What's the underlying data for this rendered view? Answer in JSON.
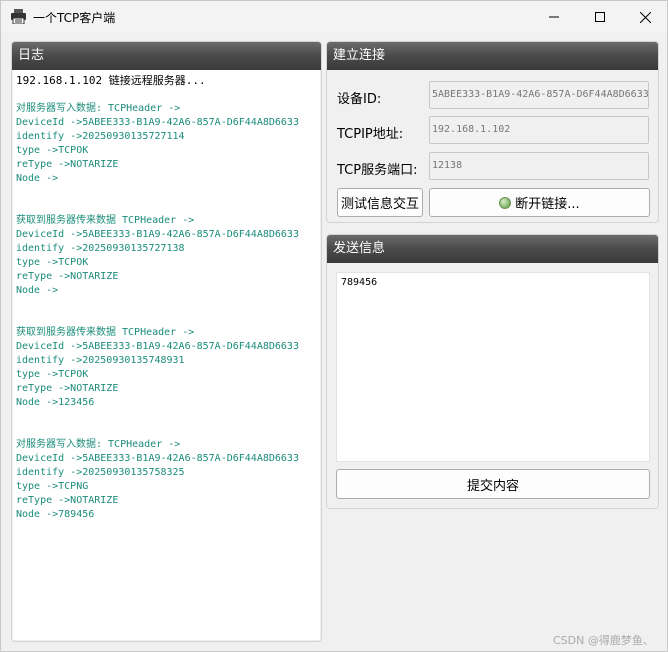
{
  "window": {
    "title": "一个TCP客户端"
  },
  "log_panel": {
    "header": "日志",
    "lines": [
      {
        "text": "192.168.1.102 链接远程服务器...",
        "style": "black"
      },
      {
        "text": "",
        "style": "blank"
      },
      {
        "text": "对服务器写入数据: TCPHeader ->",
        "style": "green"
      },
      {
        "text": "DeviceId ->5ABEE333-B1A9-42A6-857A-D6F44A8D6633",
        "style": "green"
      },
      {
        "text": "identify ->20250930135727114",
        "style": "green"
      },
      {
        "text": "type ->TCPOK",
        "style": "green"
      },
      {
        "text": "reType ->NOTARIZE",
        "style": "green"
      },
      {
        "text": "Node ->",
        "style": "green"
      },
      {
        "text": "",
        "style": "blank"
      },
      {
        "text": "",
        "style": "blank"
      },
      {
        "text": "获取到服务器传来数据 TCPHeader ->",
        "style": "green"
      },
      {
        "text": "DeviceId ->5ABEE333-B1A9-42A6-857A-D6F44A8D6633",
        "style": "green"
      },
      {
        "text": "identify ->20250930135727138",
        "style": "green"
      },
      {
        "text": "type ->TCPOK",
        "style": "green"
      },
      {
        "text": "reType ->NOTARIZE",
        "style": "green"
      },
      {
        "text": "Node ->",
        "style": "green"
      },
      {
        "text": "",
        "style": "blank"
      },
      {
        "text": "",
        "style": "blank"
      },
      {
        "text": "获取到服务器传来数据 TCPHeader ->",
        "style": "green"
      },
      {
        "text": "DeviceId ->5ABEE333-B1A9-42A6-857A-D6F44A8D6633",
        "style": "green"
      },
      {
        "text": "identify ->20250930135748931",
        "style": "green"
      },
      {
        "text": "type ->TCPOK",
        "style": "green"
      },
      {
        "text": "reType ->NOTARIZE",
        "style": "green"
      },
      {
        "text": "Node ->123456",
        "style": "green"
      },
      {
        "text": "",
        "style": "blank"
      },
      {
        "text": "",
        "style": "blank"
      },
      {
        "text": "对服务器写入数据: TCPHeader ->",
        "style": "green"
      },
      {
        "text": "DeviceId ->5ABEE333-B1A9-42A6-857A-D6F44A8D6633",
        "style": "green"
      },
      {
        "text": "identify ->20250930135758325",
        "style": "green"
      },
      {
        "text": "type ->TCPNG",
        "style": "green"
      },
      {
        "text": "reType ->NOTARIZE",
        "style": "green"
      },
      {
        "text": "Node ->789456",
        "style": "green"
      }
    ]
  },
  "connection_panel": {
    "header": "建立连接",
    "device_id_label": "设备ID:",
    "device_id_value": "5ABEE333-B1A9-42A6-857A-D6F44A8D6633",
    "ip_label": "TCPIP地址:",
    "ip_value": "192.168.1.102",
    "port_label": "TCP服务端口:",
    "port_value": "12138",
    "test_button": "测试信息交互",
    "disconnect_button": "断开链接..."
  },
  "send_panel": {
    "header": "发送信息",
    "message": "789456",
    "submit_button": "提交内容"
  },
  "watermark": "CSDN @得鹿梦鱼、",
  "colors": {
    "log_green": "#1b8c7a",
    "header_dark": "#4a4a4a",
    "status_green": "#8fbf74"
  }
}
